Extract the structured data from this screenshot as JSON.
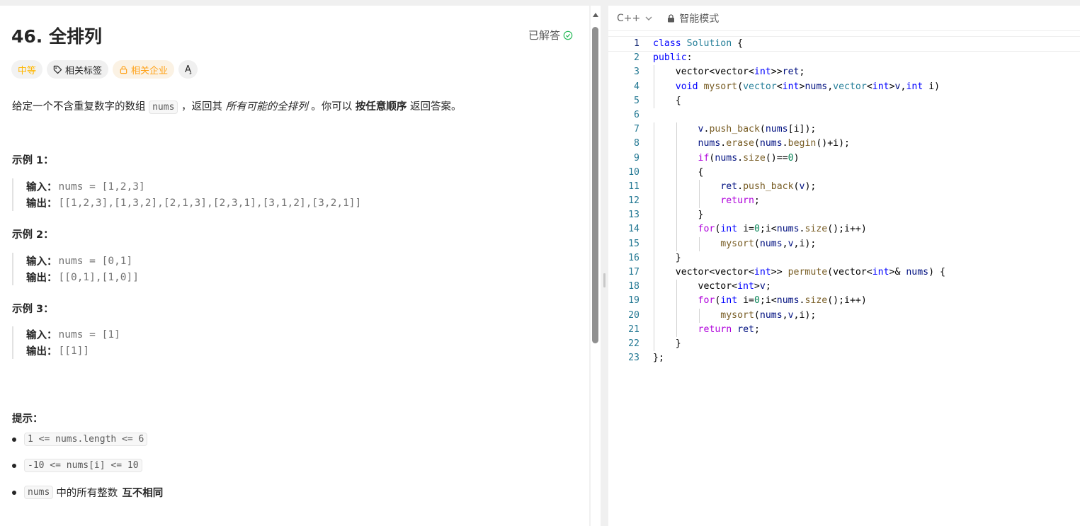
{
  "problem": {
    "title": "46. 全排列",
    "status": "已解答",
    "tags": {
      "difficulty": "中等",
      "related_tags": "相关标签",
      "related_companies": "相关企业",
      "translate": "A̧"
    },
    "description": {
      "part1": "给定一个不含重复数字的数组",
      "code1": "nums",
      "part2": "，返回其",
      "italic": "所有可能的全排列",
      "part3": "。你可以",
      "bold": "按任意顺序",
      "part4": "返回答案。"
    },
    "examples": [
      {
        "title": "示例 1：",
        "input_label": "输入：",
        "input": "nums = [1,2,3]",
        "output_label": "输出：",
        "output": "[[1,2,3],[1,3,2],[2,1,3],[2,3,1],[3,1,2],[3,2,1]]"
      },
      {
        "title": "示例 2：",
        "input_label": "输入：",
        "input": "nums = [0,1]",
        "output_label": "输出：",
        "output": "[[0,1],[1,0]]"
      },
      {
        "title": "示例 3：",
        "input_label": "输入：",
        "input": "nums = [1]",
        "output_label": "输出：",
        "output": "[[1]]"
      }
    ],
    "hints": {
      "title": "提示：",
      "items": [
        {
          "code": "1 <= nums.length <= 6",
          "text": "",
          "bold": ""
        },
        {
          "code": "-10 <= nums[i] <= 10",
          "text": "",
          "bold": ""
        },
        {
          "code": "nums",
          "text": "中的所有整数",
          "bold": "互不相同"
        }
      ]
    }
  },
  "editor": {
    "language": "C++",
    "mode": "智能模式",
    "lines": [
      {
        "n": "1",
        "code": "class Solution {"
      },
      {
        "n": "2",
        "code": "public:"
      },
      {
        "n": "3",
        "code": "    vector<vector<int>>ret;"
      },
      {
        "n": "4",
        "code": "    void mysort(vector<int>nums,vector<int>v,int i)"
      },
      {
        "n": "5",
        "code": "    {"
      },
      {
        "n": "6",
        "code": ""
      },
      {
        "n": "7",
        "code": "        v.push_back(nums[i]);"
      },
      {
        "n": "8",
        "code": "        nums.erase(nums.begin()+i);"
      },
      {
        "n": "9",
        "code": "        if(nums.size()==0)"
      },
      {
        "n": "10",
        "code": "        {"
      },
      {
        "n": "11",
        "code": "            ret.push_back(v);"
      },
      {
        "n": "12",
        "code": "            return;"
      },
      {
        "n": "13",
        "code": "        }"
      },
      {
        "n": "14",
        "code": "        for(int i=0;i<nums.size();i++)"
      },
      {
        "n": "15",
        "code": "            mysort(nums,v,i);"
      },
      {
        "n": "16",
        "code": "    }"
      },
      {
        "n": "17",
        "code": "    vector<vector<int>> permute(vector<int>& nums) {"
      },
      {
        "n": "18",
        "code": "        vector<int>v;"
      },
      {
        "n": "19",
        "code": "        for(int i=0;i<nums.size();i++)"
      },
      {
        "n": "20",
        "code": "            mysort(nums,v,i);"
      },
      {
        "n": "21",
        "code": "        return ret;"
      },
      {
        "n": "22",
        "code": "    }"
      },
      {
        "n": "23",
        "code": "};"
      }
    ]
  }
}
